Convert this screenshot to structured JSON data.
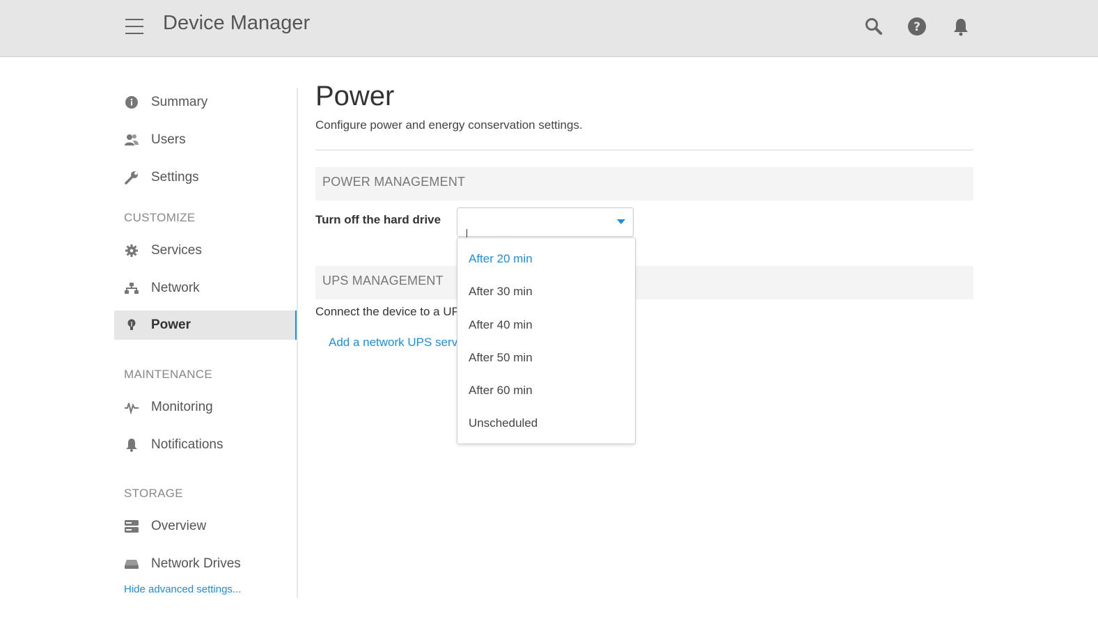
{
  "header": {
    "app_title": "Device Manager",
    "icons": [
      "menu-icon",
      "search-icon",
      "help-icon",
      "bell-icon"
    ]
  },
  "sidebar": {
    "main_items": [
      {
        "label": "Summary",
        "icon": "info-icon"
      },
      {
        "label": "Users",
        "icon": "users-icon"
      },
      {
        "label": "Settings",
        "icon": "wrench-icon"
      }
    ],
    "customize": {
      "heading": "CUSTOMIZE",
      "items": [
        {
          "label": "Services",
          "icon": "gear-icon"
        },
        {
          "label": "Network",
          "icon": "network-icon"
        },
        {
          "label": "Power",
          "icon": "bulb-icon",
          "active": true
        }
      ]
    },
    "maintenance": {
      "heading": "MAINTENANCE",
      "items": [
        {
          "label": "Monitoring",
          "icon": "pulse-icon"
        },
        {
          "label": "Notifications",
          "icon": "bell-icon"
        }
      ]
    },
    "storage": {
      "heading": "STORAGE",
      "items": [
        {
          "label": "Overview",
          "icon": "server-icon"
        },
        {
          "label": "Network Drives",
          "icon": "drive-icon"
        }
      ]
    },
    "hide_link": "Hide advanced settings..."
  },
  "main": {
    "title": "Power",
    "subtitle": "Configure power and energy conservation settings.",
    "power_management": {
      "heading": "POWER MANAGEMENT",
      "field_label": "Turn off the hard drive",
      "select_value": "",
      "options": [
        "After 20 min",
        "After 30 min",
        "After 40 min",
        "After 50 min",
        "After 60 min",
        "Unscheduled"
      ],
      "highlighted_option": "After 20 min"
    },
    "ups_management": {
      "heading": "UPS MANAGEMENT",
      "text": "Connect the device to a UPS",
      "link": "Add a network UPS server"
    }
  },
  "colors": {
    "accent": "#1a8fe0",
    "header_bg": "#e6e6e6",
    "section_bg": "#f4f4f4"
  }
}
